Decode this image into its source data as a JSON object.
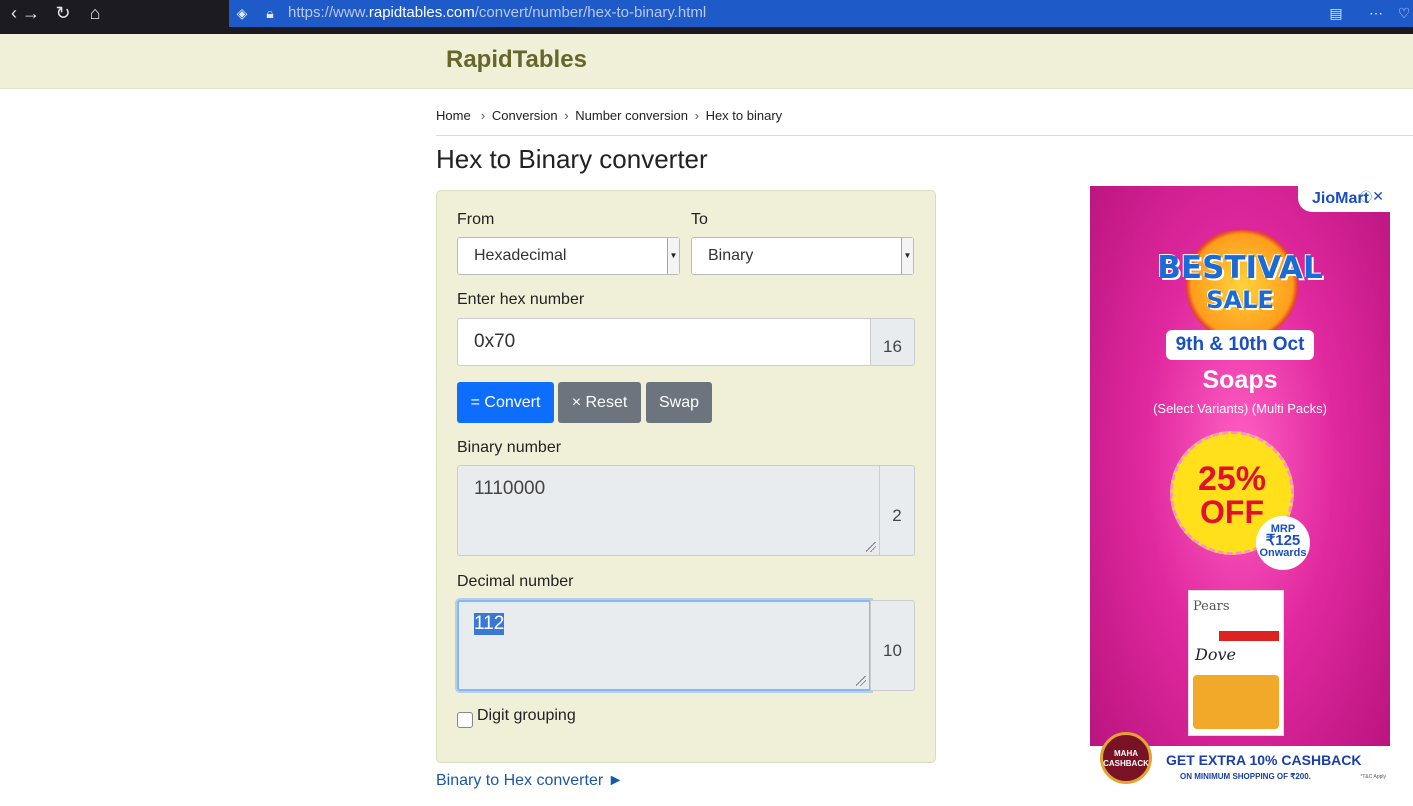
{
  "browser": {
    "url_prefix": "https://www.",
    "url_host": "rapidtables.com",
    "url_path": "/convert/number/hex-to-binary.html"
  },
  "site": {
    "logo": "RapidTables"
  },
  "breadcrumb": [
    "Home",
    "Conversion",
    "Number conversion",
    "Hex to binary"
  ],
  "page_title": "Hex to Binary converter",
  "converter": {
    "from_label": "From",
    "from_value": "Hexadecimal",
    "to_label": "To",
    "to_value": "Binary",
    "input_label": "Enter hex number",
    "input_value": "0x70",
    "input_base": "16",
    "convert_button": "= Convert",
    "reset_button": "× Reset",
    "swap_button": "Swap",
    "binary_label": "Binary number",
    "binary_value": "1110000",
    "binary_base": "2",
    "decimal_label": "Decimal number",
    "decimal_value": "112",
    "decimal_base": "10",
    "digit_grouping_label": "Digit grouping"
  },
  "footer_link": "Binary to Hex converter ►",
  "ad": {
    "brand": "JioMart",
    "title_line1": "BESTIVAL",
    "title_line2": "SALE",
    "dates": "9th & 10th Oct",
    "product": "Soaps",
    "variants": "(Select Variants) (Multi Packs)",
    "discount_1": "25%",
    "discount_2": "OFF",
    "mrp_label": "MRP",
    "mrp_price": "₹125",
    "mrp_note": "Onwards",
    "pack_brand_1": "Pears",
    "pack_brand_2": "Dove",
    "badge": "MAHA CASHBACK",
    "cashback": "GET EXTRA 10% CASHBACK",
    "cashback_note": "ON MINIMUM SHOPPING OF ₹200.",
    "tc": "*T&C Apply"
  },
  "colors": {
    "header_bg": "#f0f0d9",
    "primary": "#0d6efd",
    "secondary": "#6c757d",
    "link": "#1a57a8"
  }
}
